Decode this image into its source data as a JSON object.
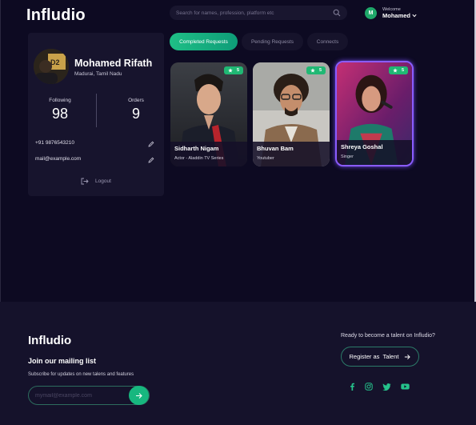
{
  "app": {
    "logo": "Infludio"
  },
  "search": {
    "placeholder": "Search for names, profession, platform etc"
  },
  "user": {
    "initial": "M",
    "welcome": "Welcome",
    "name": "Mohamed"
  },
  "profile": {
    "name": "Mohamed Rifath",
    "location": "Madurai, Tamil Nadu",
    "following_label": "Following",
    "following_value": "98",
    "orders_label": "Orders",
    "orders_value": "9",
    "phone": "+91 9876543210",
    "email": "mail@example.com",
    "logout_label": "Logout"
  },
  "tabs": [
    {
      "label": "Completed Requests",
      "active": true
    },
    {
      "label": "Pending Requests",
      "active": false
    },
    {
      "label": "Connects",
      "active": false
    }
  ],
  "cards": [
    {
      "name": "Sidharth Nigam",
      "role": "Actor - Aladdin TV Series",
      "rating": "5"
    },
    {
      "name": "Bhuvan Bam",
      "role": "Youtuber",
      "rating": "5"
    },
    {
      "name": "Shreya Goshal",
      "role": "Singer",
      "rating": "5",
      "selected": true
    }
  ],
  "footer": {
    "logo": "Infludio",
    "join_title": "Join our mailing list",
    "join_sub": "Subscribe for updates on new talens and features",
    "email_placeholder": "mymail@example.com",
    "ready_text": "Ready to become a talent on Infludio?",
    "register_label": "Register as  Talent",
    "social": [
      "facebook-icon",
      "instagram-icon",
      "twitter-icon",
      "youtube-icon"
    ]
  },
  "colors": {
    "accent": "#1fbf86",
    "background": "#0d0a22",
    "card": "#17142d",
    "highlight": "#8a5cff"
  }
}
